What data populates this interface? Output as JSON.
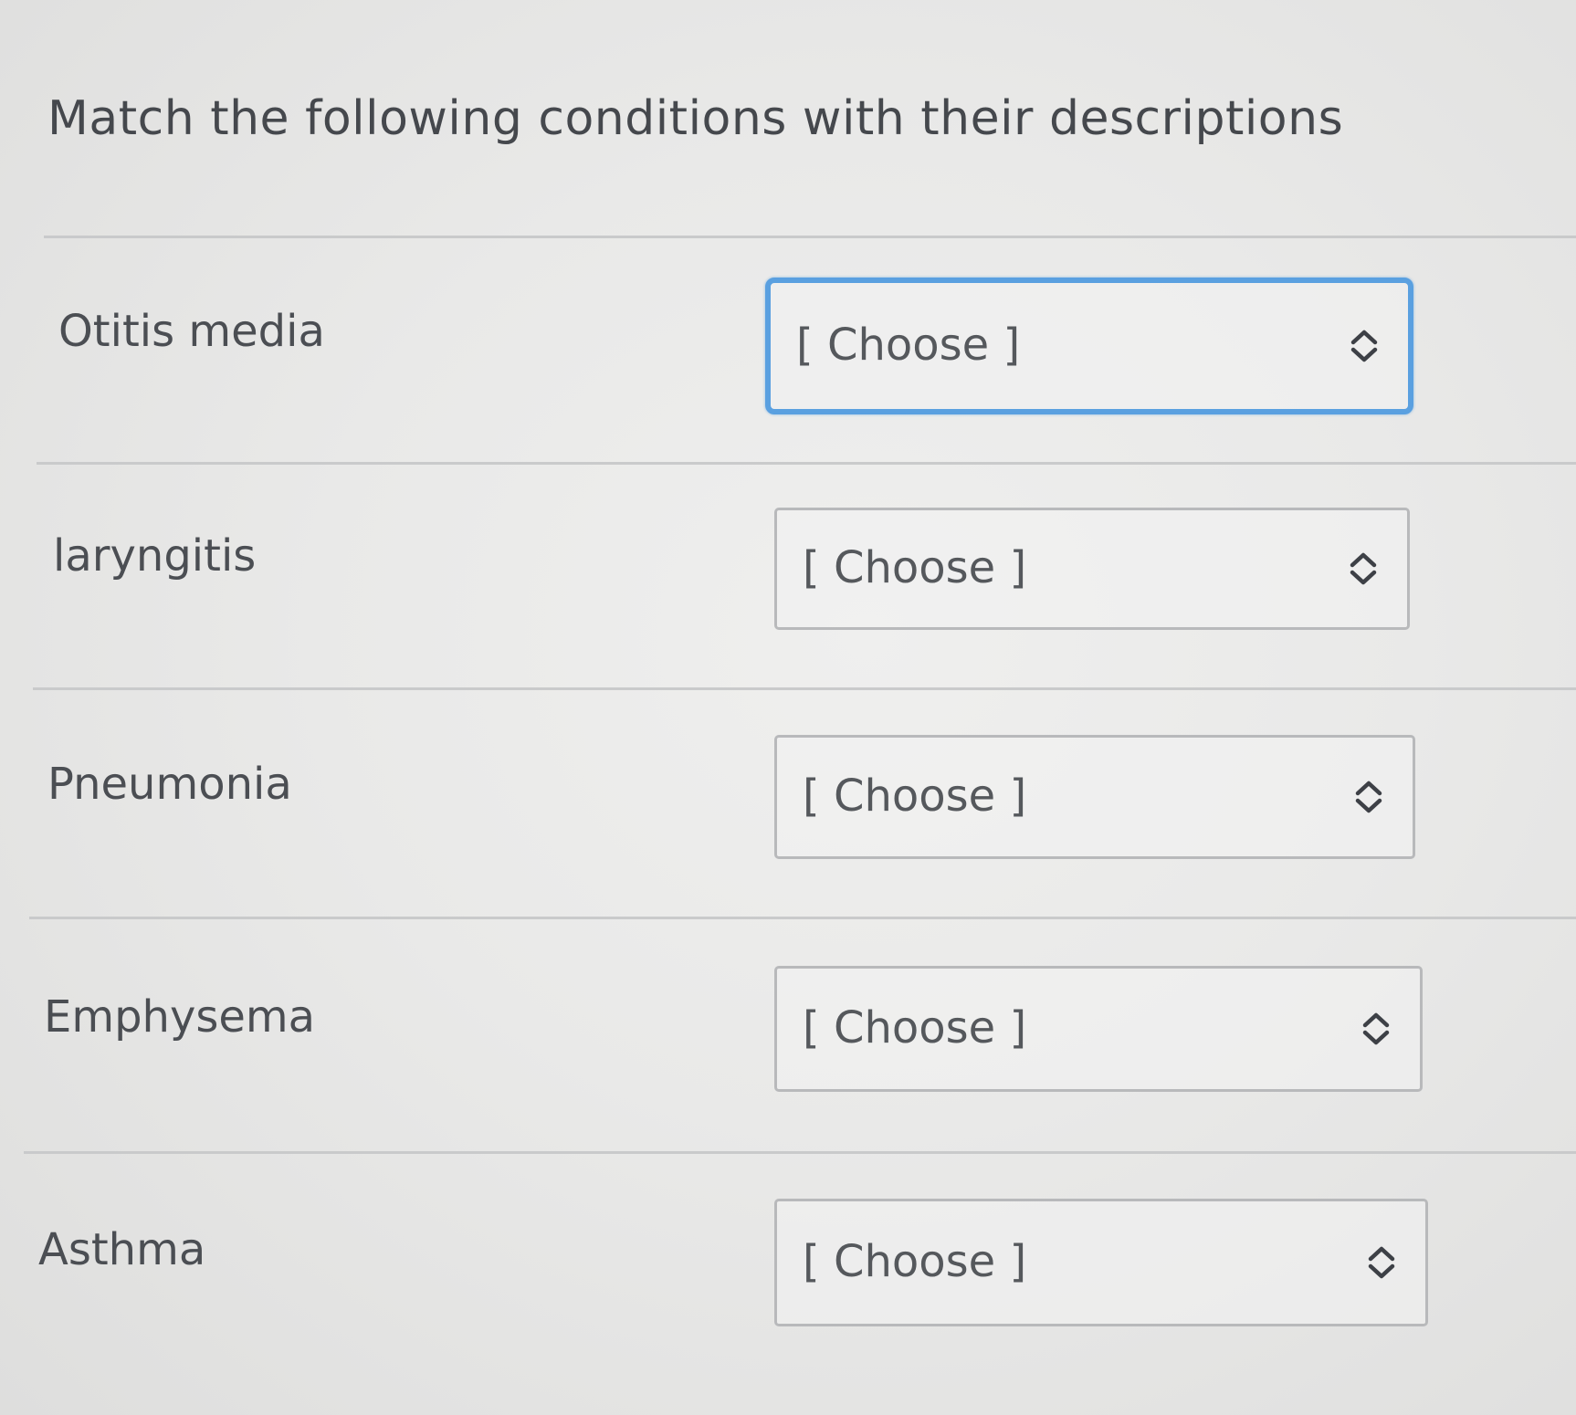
{
  "prompt": "Match the following conditions with their descriptions",
  "questions": [
    {
      "condition": "Otitis media",
      "selected": "[ Choose ]",
      "focused": true
    },
    {
      "condition": "laryngitis",
      "selected": "[ Choose ]",
      "focused": false
    },
    {
      "condition": "Pneumonia",
      "selected": "[ Choose ]",
      "focused": false
    },
    {
      "condition": "Emphysema",
      "selected": "[ Choose ]",
      "focused": false
    },
    {
      "condition": "Asthma",
      "selected": "[ Choose ]",
      "focused": false
    }
  ],
  "select_icon": "chevron-up-down-icon",
  "colors": {
    "focus_border": "#5aa0e0",
    "select_border": "#b8b9bb",
    "text": "#4b4e53",
    "background": "#e9e9e8"
  }
}
